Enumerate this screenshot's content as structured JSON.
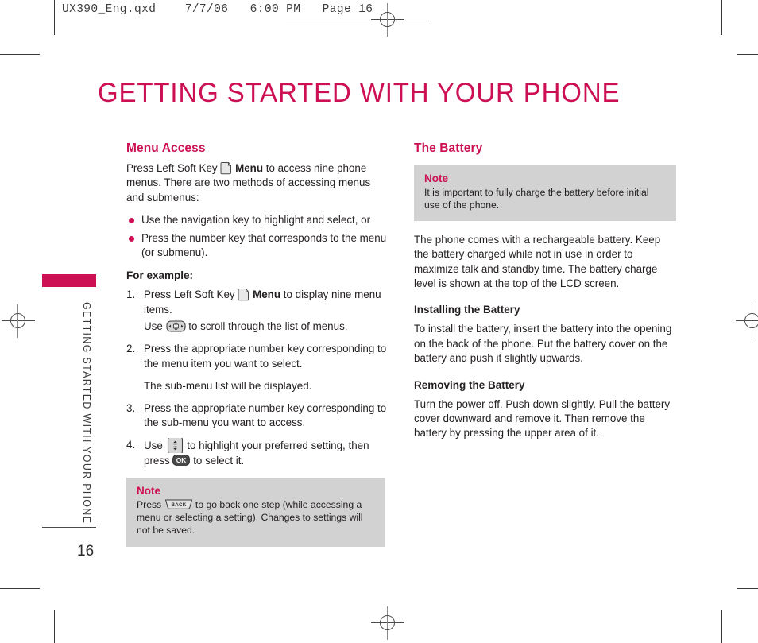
{
  "prepress": {
    "slug": "UX390_Eng.qxd    7/7/06   6:00 PM   Page 16",
    "accent_color": "#cd1054",
    "note_bg_color": "#d2d2d2"
  },
  "page": {
    "title": "GETTING STARTED WITH YOUR PHONE",
    "number": "16",
    "running_head": "GETTING STARTED WITH YOUR PHONE"
  },
  "left_column": {
    "section_title": "Menu Access",
    "intro": {
      "before_icon": "Press Left Soft Key ",
      "icon": "soft-key-icon",
      "bold_word": "Menu",
      "after_icon": " to access nine phone menus. There are two methods of accessing menus and submenus:"
    },
    "bullets": [
      "Use the navigation key to highlight and select, or",
      "Press the number key that corresponds to the menu (or submenu)."
    ],
    "for_example_label": "For example:",
    "steps": [
      {
        "number": "1.",
        "before_icon": "Press Left Soft Key ",
        "icon": "soft-key-icon",
        "bold_word": "Menu",
        "after_icon": " to display nine menu items.",
        "sub_before": "Use ",
        "sub_icon": "navigation-4way-key-icon",
        "sub_after": " to scroll through the list of menus."
      },
      {
        "number": "2.",
        "text": "Press the appropriate number key corresponding to the menu item you want to select.",
        "sub_text": "The sub-menu list will be displayed."
      },
      {
        "number": "3.",
        "text": "Press the appropriate number key corresponding to the sub-menu you want to access."
      },
      {
        "number": "4.",
        "before_icon": "Use ",
        "icon": "navigation-updown-key-icon",
        "mid_text": " to highlight your preferred setting, then press ",
        "icon2": "ok-key-icon",
        "after_icon": " to select it."
      }
    ],
    "note": {
      "title": "Note",
      "before_icon": "Press ",
      "icon": "back-key-icon",
      "after_icon": " to go back one step (while accessing a menu or selecting a setting). Changes to settings will not be saved."
    }
  },
  "right_column": {
    "section_title": "The Battery",
    "note": {
      "title": "Note",
      "text": "It is important to fully charge the battery before initial use of the phone."
    },
    "intro_paragraph": "The phone comes with a rechargeable battery. Keep the battery charged while not in use in order to maximize talk and standby time. The battery charge level is shown at the top of the LCD screen.",
    "installing": {
      "heading": "Installing the Battery",
      "text": "To install the battery, insert the battery into the opening on the back of the phone. Put the battery cover on the battery and push it slightly upwards."
    },
    "removing": {
      "heading": "Removing the Battery",
      "text": "Turn the power off. Push down slightly. Pull the battery cover downward and remove it. Then remove the battery by pressing the upper area of it."
    }
  },
  "icons": {
    "ok_label": "OK",
    "back_label": "BACK"
  }
}
